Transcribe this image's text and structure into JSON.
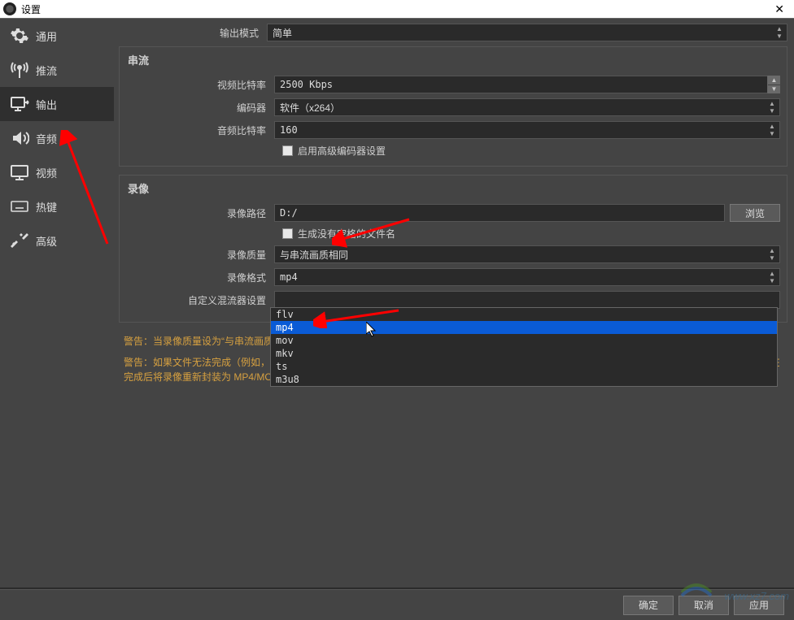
{
  "titlebar": {
    "title": "设置"
  },
  "sidebar": {
    "items": [
      {
        "label": "通用"
      },
      {
        "label": "推流"
      },
      {
        "label": "输出"
      },
      {
        "label": "音频"
      },
      {
        "label": "视频"
      },
      {
        "label": "热键"
      },
      {
        "label": "高级"
      }
    ]
  },
  "output_mode": {
    "label": "输出模式",
    "value": "简单"
  },
  "streaming": {
    "title": "串流",
    "video_bitrate_label": "视频比特率",
    "video_bitrate_value": "2500 Kbps",
    "encoder_label": "编码器",
    "encoder_value": "软件（x264）",
    "audio_bitrate_label": "音频比特率",
    "audio_bitrate_value": "160",
    "advanced_checkbox": "启用高级编码器设置"
  },
  "recording": {
    "title": "录像",
    "path_label": "录像路径",
    "path_value": "D:/",
    "browse_btn": "浏览",
    "nospace_checkbox": "生成没有空格的文件名",
    "quality_label": "录像质量",
    "quality_value": "与串流画质相同",
    "format_label": "录像格式",
    "format_value": "mp4",
    "format_options": [
      "flv",
      "mp4",
      "mov",
      "mkv",
      "ts",
      "m3u8"
    ],
    "muxer_label": "自定义混流器设置"
  },
  "warnings": {
    "w1": "警告：当录像质量设为“与串流画质相同”时，无法暂停录制。",
    "w2": "警告：如果文件无法完成（例如，由于蓝屏BSOD，掉电等），保存到 MP4/MOV 的记录将无法恢复。如果要录制多个音轨，请考虑使用 MKV 录制，并在完成后将录像重新封装为 MP4/MOV（文件→录像转封装）"
  },
  "footer": {
    "ok": "确定",
    "cancel": "取消",
    "apply": "应用"
  },
  "watermark": "www.xz7.com"
}
